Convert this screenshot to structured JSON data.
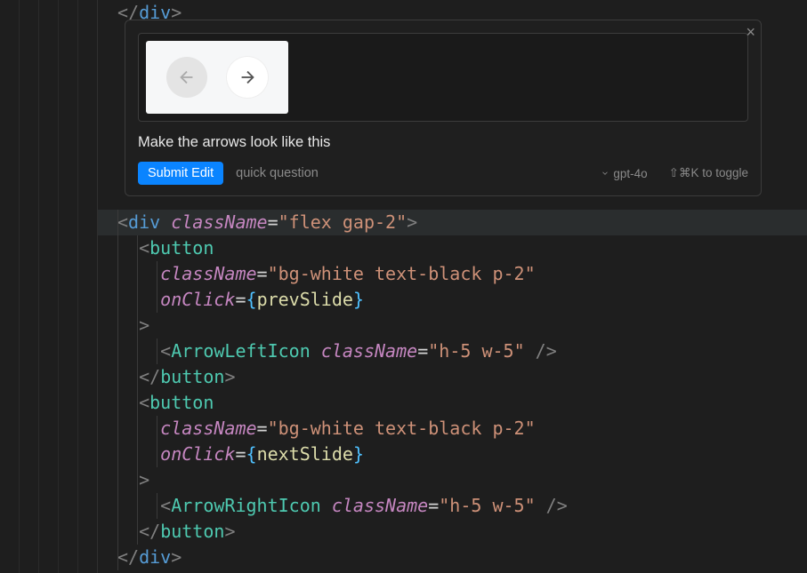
{
  "chat": {
    "prompt": "Make the arrows look like this",
    "submit_label": "Submit Edit",
    "quick_label": "quick question",
    "model": "gpt-4o",
    "shortcut_hint": "⇧⌘K to toggle",
    "attachment": {
      "description": "two circular arrow buttons, left disabled right active",
      "left_icon": "arrow-left",
      "right_icon": "arrow-right"
    }
  },
  "code": {
    "top_closing_tag": "div",
    "lines": [
      {
        "indent": 0,
        "tokens": [
          {
            "t": "punct",
            "v": "<"
          },
          {
            "t": "tagEl",
            "v": "div"
          },
          {
            "t": "punct",
            "v": " "
          },
          {
            "t": "attr",
            "v": "className"
          },
          {
            "t": "op",
            "v": "="
          },
          {
            "t": "str",
            "v": "\"flex gap-2\""
          },
          {
            "t": "punct",
            "v": ">"
          }
        ]
      },
      {
        "indent": 1,
        "tokens": [
          {
            "t": "punct",
            "v": "<"
          },
          {
            "t": "comp",
            "v": "button"
          }
        ]
      },
      {
        "indent": 2,
        "tokens": [
          {
            "t": "attr",
            "v": "className"
          },
          {
            "t": "op",
            "v": "="
          },
          {
            "t": "str",
            "v": "\"bg-white text-black p-2\""
          }
        ]
      },
      {
        "indent": 2,
        "tokens": [
          {
            "t": "attr",
            "v": "onClick"
          },
          {
            "t": "op",
            "v": "="
          },
          {
            "t": "brace",
            "v": "{"
          },
          {
            "t": "ident",
            "v": "prevSlide"
          },
          {
            "t": "brace",
            "v": "}"
          }
        ]
      },
      {
        "indent": 1,
        "tokens": [
          {
            "t": "punct",
            "v": ">"
          }
        ]
      },
      {
        "indent": 2,
        "tokens": [
          {
            "t": "punct",
            "v": "<"
          },
          {
            "t": "comp",
            "v": "ArrowLeftIcon"
          },
          {
            "t": "punct",
            "v": " "
          },
          {
            "t": "attr",
            "v": "className"
          },
          {
            "t": "op",
            "v": "="
          },
          {
            "t": "str",
            "v": "\"h-5 w-5\""
          },
          {
            "t": "punct",
            "v": " />"
          }
        ]
      },
      {
        "indent": 1,
        "tokens": [
          {
            "t": "punct",
            "v": "</"
          },
          {
            "t": "comp",
            "v": "button"
          },
          {
            "t": "punct",
            "v": ">"
          }
        ]
      },
      {
        "indent": 1,
        "tokens": [
          {
            "t": "punct",
            "v": "<"
          },
          {
            "t": "comp",
            "v": "button"
          }
        ]
      },
      {
        "indent": 2,
        "tokens": [
          {
            "t": "attr",
            "v": "className"
          },
          {
            "t": "op",
            "v": "="
          },
          {
            "t": "str",
            "v": "\"bg-white text-black p-2\""
          }
        ]
      },
      {
        "indent": 2,
        "tokens": [
          {
            "t": "attr",
            "v": "onClick"
          },
          {
            "t": "op",
            "v": "="
          },
          {
            "t": "brace",
            "v": "{"
          },
          {
            "t": "ident",
            "v": "nextSlide"
          },
          {
            "t": "brace",
            "v": "}"
          }
        ]
      },
      {
        "indent": 1,
        "tokens": [
          {
            "t": "punct",
            "v": ">"
          }
        ]
      },
      {
        "indent": 2,
        "tokens": [
          {
            "t": "punct",
            "v": "<"
          },
          {
            "t": "comp",
            "v": "ArrowRightIcon"
          },
          {
            "t": "punct",
            "v": " "
          },
          {
            "t": "attr",
            "v": "className"
          },
          {
            "t": "op",
            "v": "="
          },
          {
            "t": "str",
            "v": "\"h-5 w-5\""
          },
          {
            "t": "punct",
            "v": " />"
          }
        ]
      },
      {
        "indent": 1,
        "tokens": [
          {
            "t": "punct",
            "v": "</"
          },
          {
            "t": "comp",
            "v": "button"
          },
          {
            "t": "punct",
            "v": ">"
          }
        ]
      },
      {
        "indent": 0,
        "tokens": [
          {
            "t": "punct",
            "v": "</"
          },
          {
            "t": "tagEl",
            "v": "div"
          },
          {
            "t": "punct",
            "v": ">"
          }
        ]
      }
    ]
  }
}
